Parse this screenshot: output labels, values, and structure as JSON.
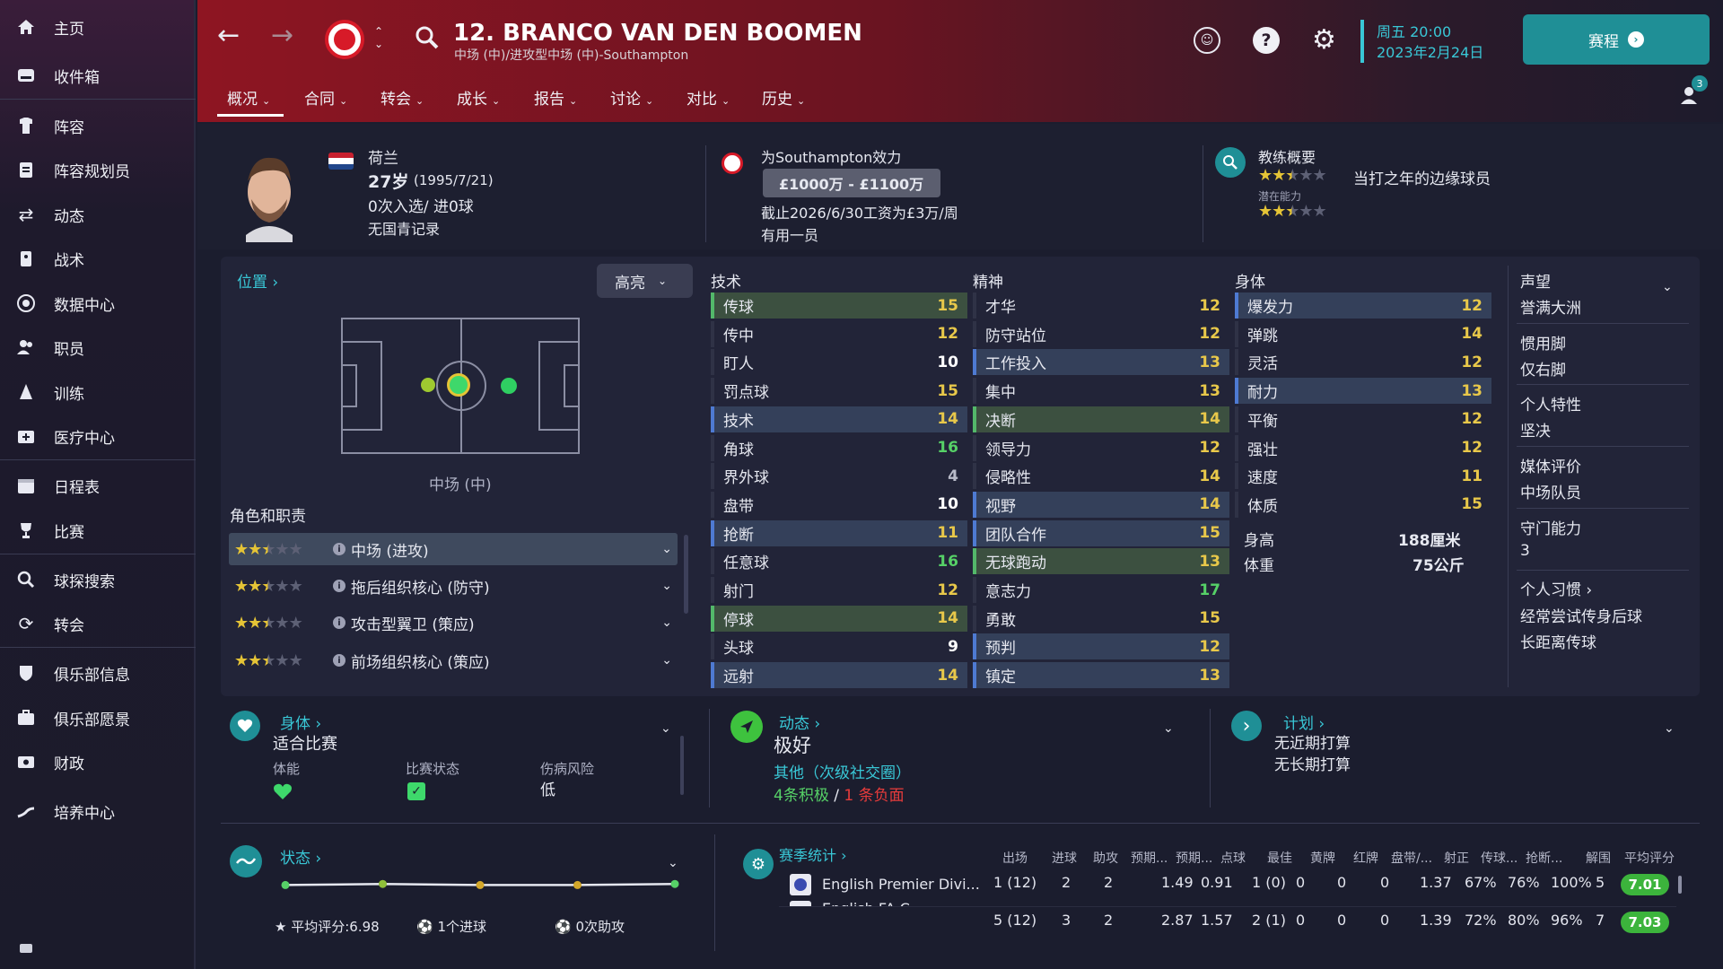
{
  "sidebar": {
    "items": [
      {
        "label": "主页",
        "icon": "home-icon"
      },
      {
        "label": "收件箱",
        "icon": "inbox-icon"
      },
      {
        "label": "阵容",
        "icon": "squad-icon"
      },
      {
        "label": "阵容规划员",
        "icon": "clipboard-icon"
      },
      {
        "label": "动态",
        "icon": "dynamics-icon"
      },
      {
        "label": "战术",
        "icon": "tactics-icon"
      },
      {
        "label": "数据中心",
        "icon": "data-hub-icon"
      },
      {
        "label": "职员",
        "icon": "staff-icon"
      },
      {
        "label": "训练",
        "icon": "training-icon"
      },
      {
        "label": "医疗中心",
        "icon": "medical-icon"
      },
      {
        "label": "日程表",
        "icon": "calendar-icon"
      },
      {
        "label": "比赛",
        "icon": "trophy-icon"
      },
      {
        "label": "球探搜索",
        "icon": "search-icon"
      },
      {
        "label": "转会",
        "icon": "transfer-icon"
      },
      {
        "label": "俱乐部信息",
        "icon": "shield-icon"
      },
      {
        "label": "俱乐部愿景",
        "icon": "vision-icon"
      },
      {
        "label": "财政",
        "icon": "finance-icon"
      },
      {
        "label": "培养中心",
        "icon": "development-icon"
      }
    ]
  },
  "header": {
    "player_title": "12. BRANCO VAN DEN BOOMEN",
    "player_subtitle": "中场 (中)/进攻型中场 (中)-Southampton",
    "day_time": "周五 20:00",
    "date": "2023年2月24日",
    "continue_label": "赛程",
    "notifications": "3",
    "tabs": [
      "概况",
      "合同",
      "转会",
      "成长",
      "报告",
      "讨论",
      "对比",
      "历史"
    ]
  },
  "profile": {
    "nationality": "荷兰",
    "age": "27岁",
    "dob": "(1995/7/21)",
    "caps": "0次入选/ 进0球",
    "youth": "无国青记录",
    "plays_for": "为Southampton效力",
    "value": "£1000万 - £1100万",
    "contract": "截止2026/6/30工资为£3万/周",
    "squad_status": "有用一员",
    "coach_title": "教练概要",
    "coach_summary": "当打之年的边缘球员",
    "potential_label": "潜在能力",
    "current_ability_stars": 2.5,
    "potential_stars": 2.5
  },
  "position": {
    "header": "位置",
    "highlight_label": "高亮",
    "position_name": "中场 (中)",
    "roles_header": "角色和职责",
    "roles": [
      {
        "name": "中场 (进攻)",
        "stars": 2.5
      },
      {
        "name": "拖后组织核心 (防守)",
        "stars": 2.5
      },
      {
        "name": "攻击型翼卫 (策应)",
        "stars": 2.5
      },
      {
        "name": "前场组织核心 (策应)",
        "stars": 2.5
      }
    ]
  },
  "attributes": {
    "technical_header": "技术",
    "mental_header": "精神",
    "physical_header": "身体",
    "technical": [
      {
        "name": "传球",
        "value": "15",
        "hl": "green",
        "color": "yellow"
      },
      {
        "name": "传中",
        "value": "12",
        "hl": "none",
        "color": "yellow"
      },
      {
        "name": "盯人",
        "value": "10",
        "hl": "none",
        "color": "white"
      },
      {
        "name": "罚点球",
        "value": "15",
        "hl": "none",
        "color": "yellow"
      },
      {
        "name": "技术",
        "value": "14",
        "hl": "blue",
        "color": "yellow"
      },
      {
        "name": "角球",
        "value": "16",
        "hl": "none",
        "color": "green"
      },
      {
        "name": "界外球",
        "value": "4",
        "hl": "none",
        "color": "gray"
      },
      {
        "name": "盘带",
        "value": "10",
        "hl": "none",
        "color": "white"
      },
      {
        "name": "抢断",
        "value": "11",
        "hl": "blue",
        "color": "yellow"
      },
      {
        "name": "任意球",
        "value": "16",
        "hl": "none",
        "color": "green"
      },
      {
        "name": "射门",
        "value": "12",
        "hl": "none",
        "color": "yellow"
      },
      {
        "name": "停球",
        "value": "14",
        "hl": "green",
        "color": "yellow"
      },
      {
        "name": "头球",
        "value": "9",
        "hl": "none",
        "color": "white"
      },
      {
        "name": "远射",
        "value": "14",
        "hl": "blue",
        "color": "yellow"
      }
    ],
    "mental": [
      {
        "name": "才华",
        "value": "12",
        "hl": "none",
        "color": "yellow"
      },
      {
        "name": "防守站位",
        "value": "12",
        "hl": "none",
        "color": "yellow"
      },
      {
        "name": "工作投入",
        "value": "13",
        "hl": "blue",
        "color": "yellow"
      },
      {
        "name": "集中",
        "value": "13",
        "hl": "none",
        "color": "yellow"
      },
      {
        "name": "决断",
        "value": "14",
        "hl": "green",
        "color": "yellow"
      },
      {
        "name": "领导力",
        "value": "12",
        "hl": "none",
        "color": "yellow"
      },
      {
        "name": "侵略性",
        "value": "14",
        "hl": "none",
        "color": "yellow"
      },
      {
        "name": "视野",
        "value": "14",
        "hl": "blue",
        "color": "yellow"
      },
      {
        "name": "团队合作",
        "value": "15",
        "hl": "blue",
        "color": "yellow"
      },
      {
        "name": "无球跑动",
        "value": "13",
        "hl": "green",
        "color": "yellow"
      },
      {
        "name": "意志力",
        "value": "17",
        "hl": "none",
        "color": "green"
      },
      {
        "name": "勇敢",
        "value": "15",
        "hl": "none",
        "color": "yellow"
      },
      {
        "name": "预判",
        "value": "12",
        "hl": "blue",
        "color": "yellow"
      },
      {
        "name": "镇定",
        "value": "13",
        "hl": "blue",
        "color": "yellow"
      }
    ],
    "physical": [
      {
        "name": "爆发力",
        "value": "12",
        "hl": "blue",
        "color": "yellow"
      },
      {
        "name": "弹跳",
        "value": "14",
        "hl": "none",
        "color": "yellow"
      },
      {
        "name": "灵活",
        "value": "12",
        "hl": "none",
        "color": "yellow"
      },
      {
        "name": "耐力",
        "value": "13",
        "hl": "blue",
        "color": "yellow"
      },
      {
        "name": "平衡",
        "value": "12",
        "hl": "none",
        "color": "yellow"
      },
      {
        "name": "强壮",
        "value": "12",
        "hl": "none",
        "color": "yellow"
      },
      {
        "name": "速度",
        "value": "11",
        "hl": "none",
        "color": "yellow"
      },
      {
        "name": "体质",
        "value": "15",
        "hl": "none",
        "color": "yellow"
      }
    ],
    "height_label": "身高",
    "height": "188厘米",
    "weight_label": "体重",
    "weight": "75公斤"
  },
  "right_panel": {
    "reputation_label": "声望",
    "reputation": "誉满大洲",
    "foot_label": "惯用脚",
    "foot": "仅右脚",
    "trait_label": "个人特性",
    "trait": "坚决",
    "media_label": "媒体评价",
    "media": "中场队员",
    "gk_label": "守门能力",
    "gk": "3",
    "habits_label": "个人习惯",
    "habits": [
      "经常尝试传身后球",
      "长距离传球"
    ]
  },
  "fitness": {
    "title": "身体",
    "status": "适合比赛",
    "condition_label": "体能",
    "match_label": "比赛状态",
    "injury_label": "伤病风险",
    "injury": "低"
  },
  "dynamics": {
    "title": "动态",
    "status": "极好",
    "group": "其他（次级社交圈）",
    "positive": "4条积极",
    "separator": " / ",
    "negative": "1 条负面"
  },
  "plans": {
    "title": "计划",
    "short": "无近期打算",
    "long": "无长期打算"
  },
  "form": {
    "title": "状态",
    "avg": "平均评分:6.98",
    "goals": "1个进球",
    "assists": "0次助攻",
    "points": [
      6.9,
      6.95,
      6.9,
      6.9,
      6.95
    ]
  },
  "season_stats": {
    "title": "赛季统计",
    "headers": [
      "出场",
      "进球",
      "助攻",
      "预期...",
      "预期...",
      "点球",
      "最佳",
      "黄牌",
      "红牌",
      "盘带/...",
      "射正",
      "传球...",
      "抢断...",
      "解围",
      "平均评分"
    ],
    "rows": [
      {
        "comp": "English Premier Divi...",
        "values": [
          "1 (12)",
          "2",
          "2",
          "1.49",
          "0.91",
          "1 (0)",
          "0",
          "0",
          "0",
          "1.37",
          "67%",
          "76%",
          "100%",
          "5",
          "7.01"
        ]
      },
      {
        "comp": "English FA C...",
        "values": [
          "",
          "",
          "",
          "",
          "",
          "",
          "",
          "",
          "",
          "",
          "",
          "",
          "",
          "",
          ""
        ]
      }
    ],
    "total": [
      "5 (12)",
      "3",
      "2",
      "2.87",
      "1.57",
      "2 (1)",
      "0",
      "0",
      "0",
      "1.39",
      "72%",
      "80%",
      "96%",
      "7",
      "7.03"
    ]
  },
  "colors": {
    "accent": "#39c7d6",
    "positive": "#56d167",
    "negative": "#e63b3b",
    "star": "#e5c436"
  }
}
